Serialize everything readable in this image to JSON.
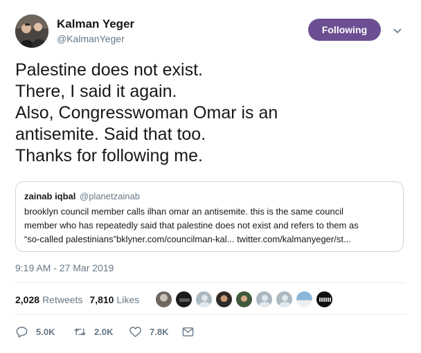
{
  "author": {
    "display_name": "Kalman Yeger",
    "handle": "@KalmanYeger"
  },
  "follow_button": {
    "label": "Following",
    "color": "#6c4f92"
  },
  "tweet": {
    "lines": [
      "Palestine does not exist.",
      "There, I said it again.",
      "Also, Congresswoman Omar is an",
      "antisemite.  Said that too.",
      "Thanks for following me."
    ],
    "timestamp": "9:19 AM - 27 Mar 2019"
  },
  "quoted_tweet": {
    "display_name": "zainab iqbal",
    "handle": "@planetzainab",
    "lines": [
      "brooklyn council member calls ilhan omar an antisemite. this is the same council",
      "member who has repeatedly said that palestine does not exist and refers to them as",
      "“so-called palestinians”bklyner.com/councilman-kal... twitter.com/kalmanyeger/st..."
    ]
  },
  "stats": {
    "retweets_count": "2,028",
    "retweets_label": "Retweets",
    "likes_count": "7,810",
    "likes_label": "Likes"
  },
  "liker_avatars": [
    "photo1",
    "dark",
    "default",
    "photo2",
    "photo3",
    "default",
    "default",
    "sky",
    "logo"
  ],
  "actions": {
    "reply_count": "5.0K",
    "retweet_count": "2.0K",
    "like_count": "7.8K"
  },
  "colors": {
    "text": "#14171a",
    "secondary": "#657786",
    "border": "#ccd6dd",
    "divider": "#e6ecf0"
  }
}
